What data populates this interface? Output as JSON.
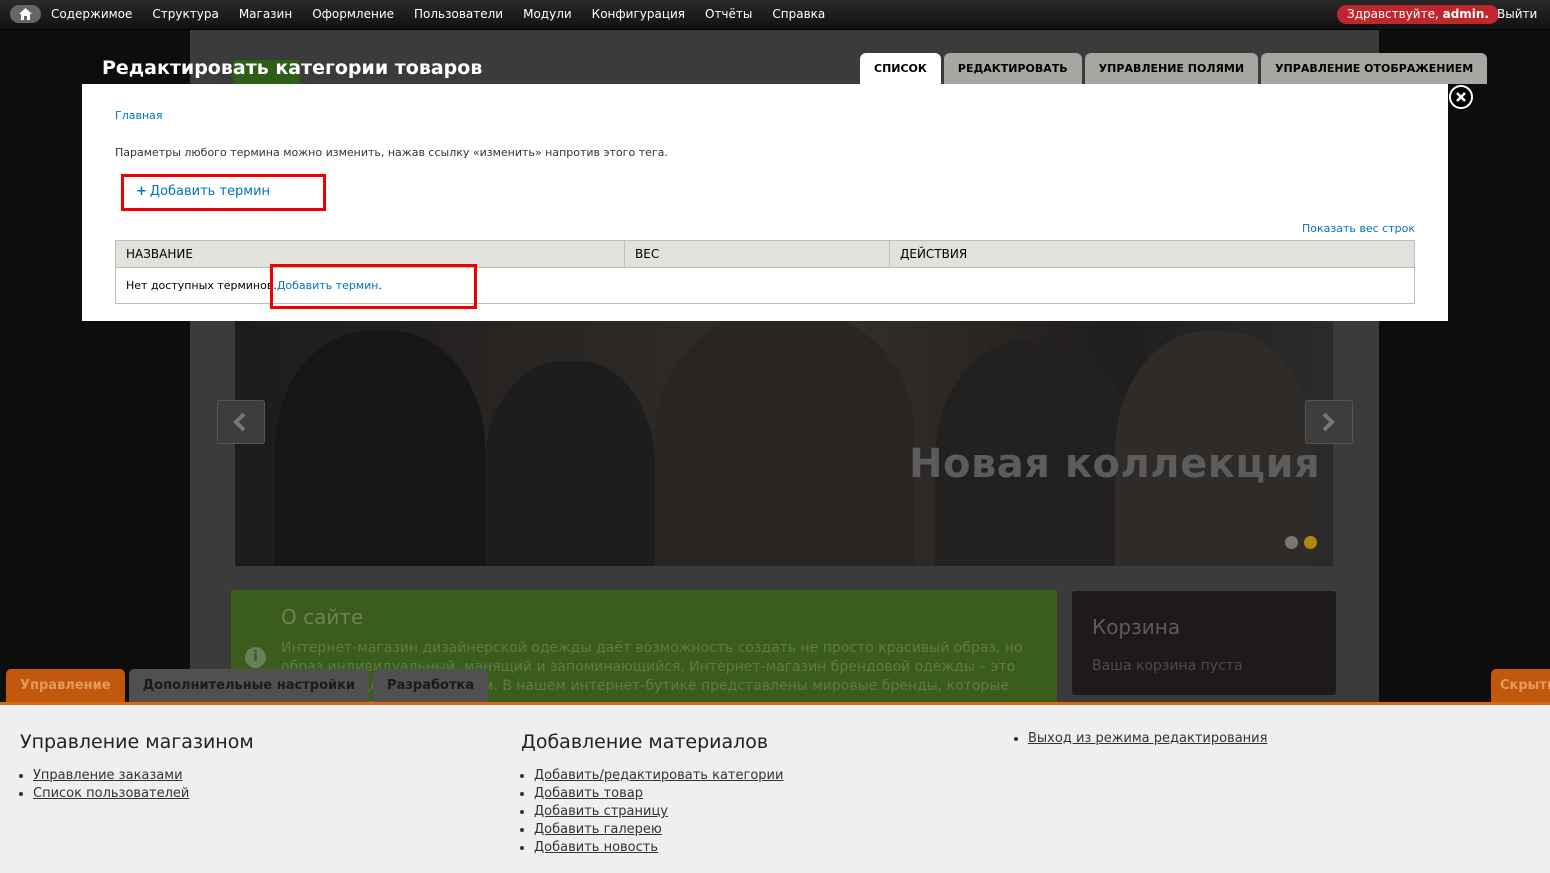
{
  "toolbar": {
    "menu": [
      "Содержимое",
      "Структура",
      "Магазин",
      "Оформление",
      "Пользователи",
      "Модули",
      "Конфигурация",
      "Отчёты",
      "Справка"
    ],
    "greeting": "Здравствуйте,",
    "username": "admin.",
    "logout": "Выйти"
  },
  "overlay": {
    "title": "Редактировать категории товаров",
    "tabs": [
      "СПИСОК",
      "РЕДАКТИРОВАТЬ",
      "УПРАВЛЕНИЕ ПОЛЯМИ",
      "УПРАВЛЕНИЕ ОТОБРАЖЕНИЕМ"
    ],
    "breadcrumb": "Главная",
    "help_text": "Параметры любого термина можно изменить, нажав ссылку «изменить» напротив этого тега.",
    "add_term": "Добавить термин",
    "show_weights": "Показать вес строк",
    "table": {
      "headers": [
        "НАЗВАНИЕ",
        "ВЕС",
        "ДЕЙСТВИЯ"
      ],
      "empty_text": "Нет доступных терминов.",
      "empty_link": "Добавить термин"
    }
  },
  "site": {
    "slide_text": "Новая коллекция",
    "about_title": "О сайте",
    "about_text": "Интернет-магазин дизайнерской одежды даёт возможность создать не просто красивый образ, но образ индивидуальный, манящий и запоминающийся. Интернет-магазин брендовой одежды – это роскошь с доставкой на дом. В нашем интернет-бутике представлены мировые бренды, которые сложно найти в обычном",
    "cart_title": "Корзина",
    "cart_text": "Ваша корзина пуста"
  },
  "shortcuts": {
    "tabs": [
      "Управление",
      "Дополнительные настройки",
      "Разработка"
    ],
    "hide": "Скрыть",
    "col1_title": "Управление магазином",
    "col1_links": [
      "Управление заказами",
      "Список пользователей"
    ],
    "col2_title": "Добавление материалов",
    "col2_links": [
      "Добавить/редактировать категории",
      "Добавить товар",
      "Добавить страницу",
      "Добавить галерею",
      "Добавить новость"
    ],
    "col3_links": [
      "Выход из режима редактирования"
    ]
  },
  "colors": {
    "accent_red": "#c0272d",
    "link_blue": "#0074bd",
    "admin_orange": "#c2580c",
    "highlight": "#e00000"
  }
}
